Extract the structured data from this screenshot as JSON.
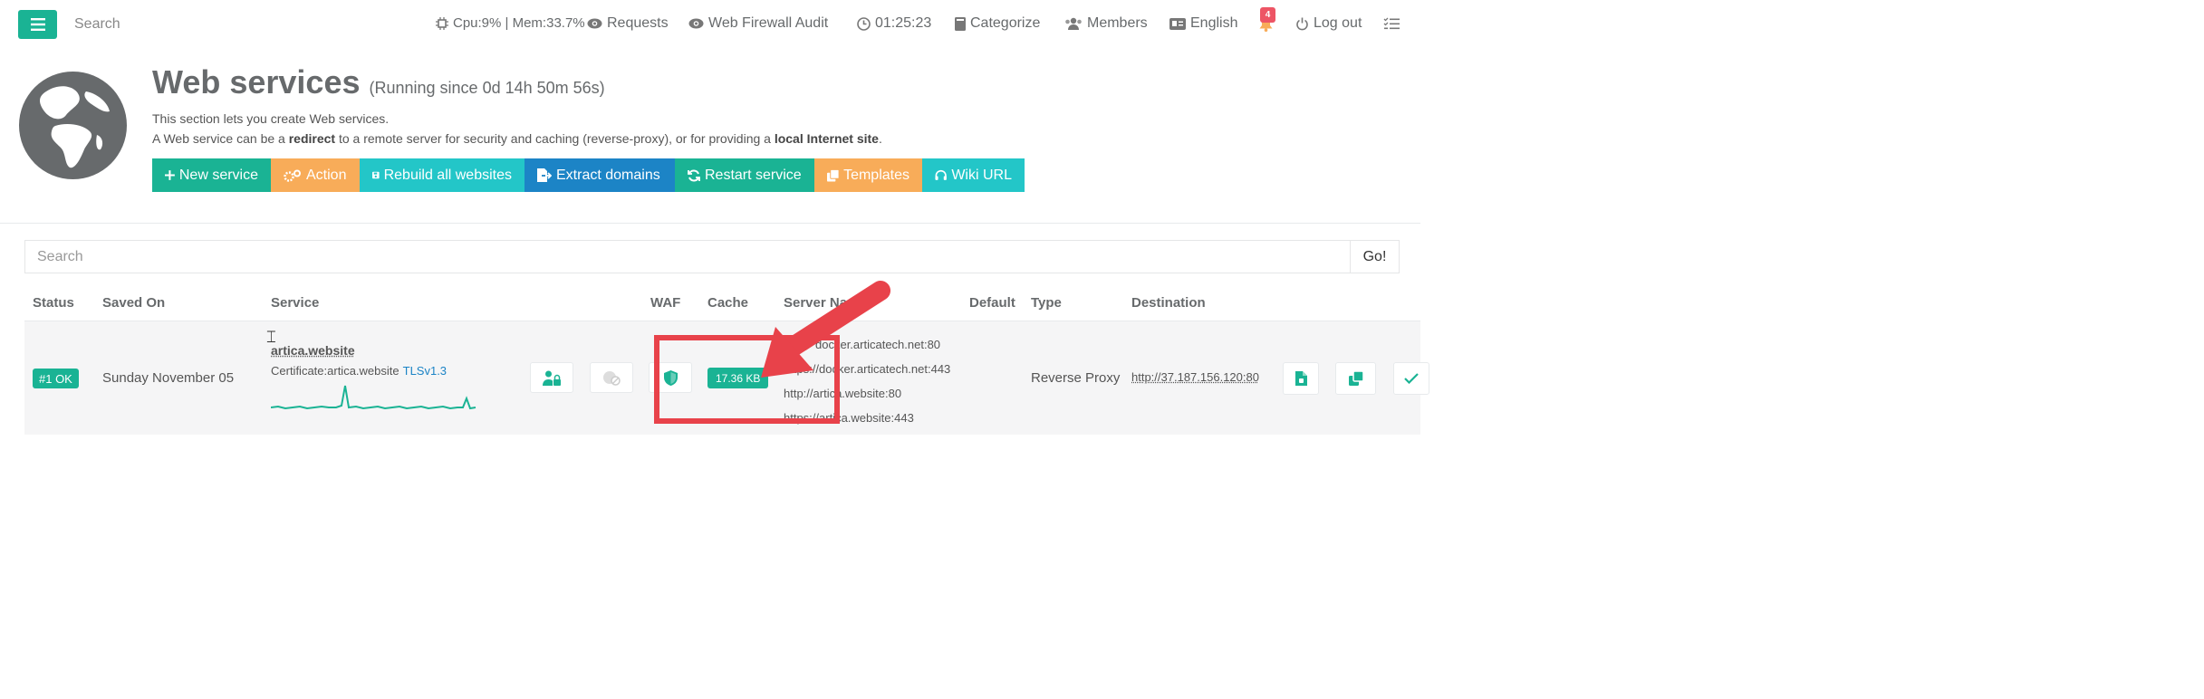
{
  "topbar": {
    "search_placeholder": "Search",
    "cpu_mem": "Cpu:9% | Mem:33.7%",
    "requests": "Requests",
    "waf_audit": "Web Firewall Audit",
    "clock": "01:25:23",
    "categorize": "Categorize",
    "members": "Members",
    "language": "English",
    "notifications_count": "4",
    "logout": "Log out"
  },
  "header": {
    "title": "Web services",
    "running_since": "(Running since 0d 14h 50m 56s)",
    "line1": "This section lets you create Web services.",
    "line2_a": "A Web service can be a ",
    "line2_b": "redirect",
    "line2_c": " to a remote server for security and caching (reverse-proxy), or for providing a ",
    "line2_d": "local Internet site",
    "line2_e": "."
  },
  "actions": {
    "new_service": "New service",
    "action": "Action",
    "rebuild": "Rebuild all websites",
    "extract": "Extract domains",
    "restart": "Restart service",
    "templates": "Templates",
    "wiki": "Wiki URL"
  },
  "table": {
    "search_placeholder": "Search",
    "go_label": "Go!",
    "headers": {
      "status": "Status",
      "saved_on": "Saved On",
      "service": "Service",
      "waf": "WAF",
      "cache": "Cache",
      "server_names": "Server Nam",
      "default": "Default",
      "type": "Type",
      "destination": "Destination"
    },
    "rows": [
      {
        "status": "#1 OK",
        "saved_on": "Sunday November 05",
        "service_name": "artica.website",
        "certificate": "Certificate:artica.website",
        "tls": "TLSv1.3",
        "cache": "17.36 KB",
        "servers": [
          "docker.articatech.net:80",
          "https://docker.articatech.net:443",
          "http://artica.website:80",
          "https://artica.website:443"
        ],
        "type": "Reverse Proxy",
        "destination": "http://37.187.156.120:80"
      }
    ]
  },
  "colors": {
    "primary": "#1ab394",
    "warning": "#f8ac59",
    "info": "#23c6c8",
    "success_blue": "#1c84c6",
    "annotation_red": "#e8424a"
  }
}
